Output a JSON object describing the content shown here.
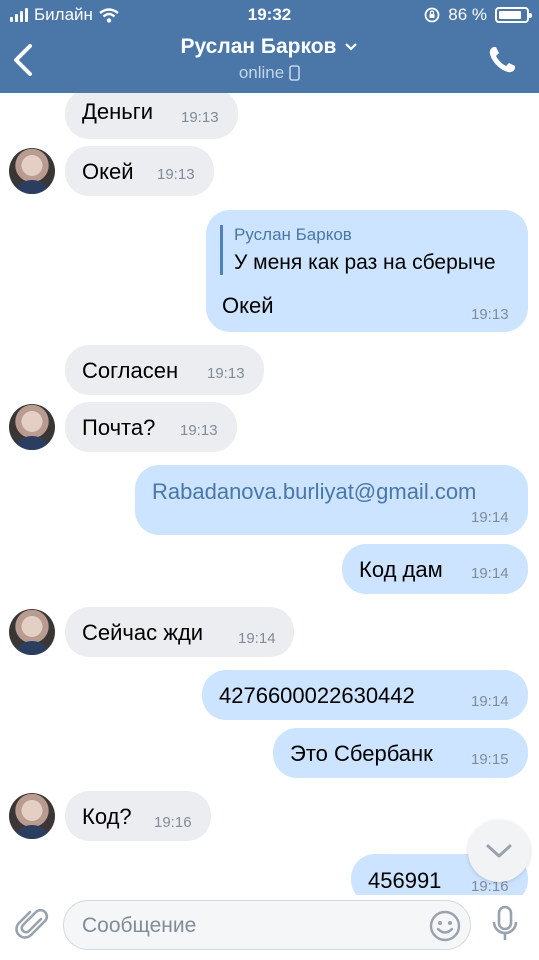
{
  "status_bar": {
    "carrier": "Билайн",
    "time": "19:32",
    "battery_text": "86 %",
    "battery_level": 0.86
  },
  "header": {
    "name": "Руслан Барков",
    "status": "online"
  },
  "messages": [
    {
      "text": "Деньги",
      "time": "19:13",
      "direction": "in"
    },
    {
      "text": "Окей",
      "time": "19:13",
      "direction": "in"
    },
    {
      "quote_author": "Руслан Барков",
      "quote_text": "У меня как раз на сберыче",
      "text": "Окей",
      "time": "19:13",
      "direction": "out"
    },
    {
      "text": "Согласен",
      "time": "19:13",
      "direction": "in"
    },
    {
      "text": "Почта?",
      "time": "19:13",
      "direction": "in"
    },
    {
      "text": "Rabadanova.burliyat@gmail.com",
      "time": "19:14",
      "direction": "out"
    },
    {
      "text": "Код дам",
      "time": "19:14",
      "direction": "out"
    },
    {
      "text": "Сейчас жди",
      "time": "19:14",
      "direction": "in"
    },
    {
      "text": "4276600022630442",
      "time": "19:14",
      "direction": "out"
    },
    {
      "text": "Это Сбербанк",
      "time": "19:15",
      "direction": "out"
    },
    {
      "text": "Код?",
      "time": "19:16",
      "direction": "in"
    },
    {
      "text": "456991",
      "time": "19:16",
      "direction": "out"
    }
  ],
  "composer": {
    "placeholder": "Сообщение"
  },
  "colors": {
    "header": "#4a76a8",
    "incoming_bubble": "#ebedf0",
    "outgoing_bubble": "#cce4ff"
  }
}
